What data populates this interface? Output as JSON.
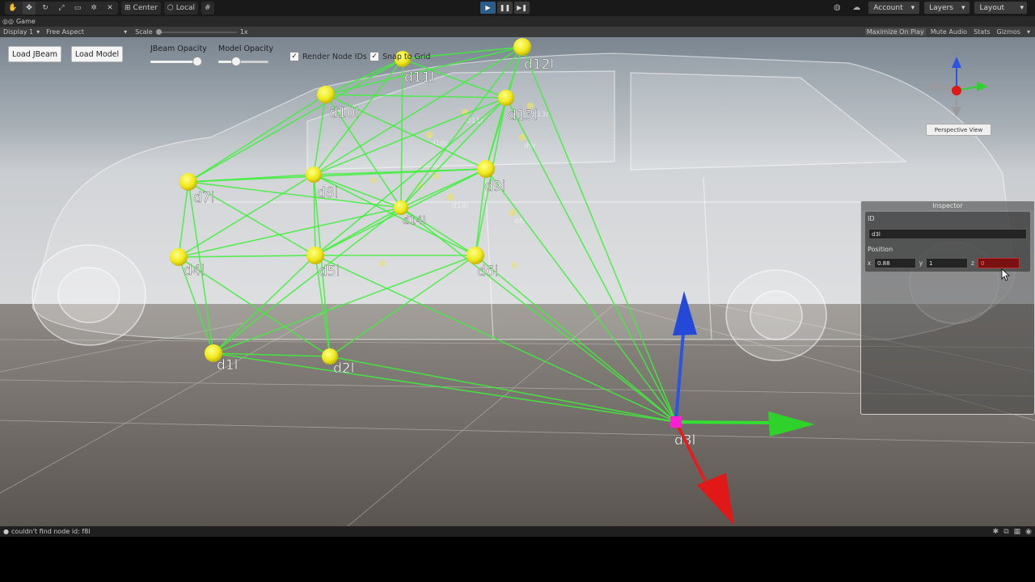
{
  "toolbar": {
    "tools": [
      "hand-icon",
      "move-icon",
      "rotate-icon",
      "scale-icon",
      "rect-icon",
      "transform-icon",
      "custom-tool-icon"
    ],
    "pivot": "Center",
    "space": "Local",
    "account": "Account",
    "layers": "Layers",
    "layout": "Layout"
  },
  "tab": {
    "label": "Game"
  },
  "gamebar": {
    "display": "Display 1",
    "aspect": "Free Aspect",
    "scale_label": "Scale",
    "scale_value": "1x",
    "maximize": "Maximize On Play",
    "mute": "Mute Audio",
    "stats": "Stats",
    "gizmos": "Gizmos"
  },
  "overlay": {
    "load_jbeam": "Load JBeam",
    "load_model": "Load Model",
    "jbeam_opacity_label": "JBeam Opacity",
    "jbeam_opacity_value": 0.97,
    "model_opacity_label": "Model Opacity",
    "model_opacity_value": 0.3,
    "render_ids_label": "Render Node IDs",
    "render_ids_checked": true,
    "snap_label": "Snap to Grid",
    "snap_checked": true,
    "perspective": "Perspective View"
  },
  "nodes": [
    {
      "id": "d1l",
      "label": "d1l"
    },
    {
      "id": "d2l",
      "label": "d2l"
    },
    {
      "id": "d3l",
      "label": "d3l"
    },
    {
      "id": "d4l",
      "label": "d4l"
    },
    {
      "id": "d5l",
      "label": "d5l"
    },
    {
      "id": "d6l",
      "label": "d6l"
    },
    {
      "id": "d7l",
      "label": "d7l"
    },
    {
      "id": "d8l",
      "label": "d8l"
    },
    {
      "id": "d9l",
      "label": "d9l"
    },
    {
      "id": "d10l",
      "label": "d10l"
    },
    {
      "id": "d11l",
      "label": "d11l"
    },
    {
      "id": "d12l",
      "label": "d12l"
    },
    {
      "id": "d13l",
      "label": "d13l"
    },
    {
      "id": "d14l",
      "label": "d14l"
    }
  ],
  "far_labels": [
    "d11r",
    "d13r",
    "d10r",
    "d14r",
    "d6r",
    "d9r"
  ],
  "inspector": {
    "title": "Inspector",
    "id_label": "ID",
    "id_value": "d3l",
    "position_label": "Position",
    "x_label": "x",
    "x_value": "0.88",
    "y_label": "y",
    "y_value": "1",
    "z_label": "z",
    "z_value": "0"
  },
  "status": {
    "message": "couldn't find node id: f8l"
  },
  "colors": {
    "beam": "#3ef03a",
    "node": "#f4ee1e",
    "selected": "#ff1fd2",
    "gizmo_x": "#e02020",
    "gizmo_y": "#2060e0",
    "gizmo_z": "#30e030"
  }
}
